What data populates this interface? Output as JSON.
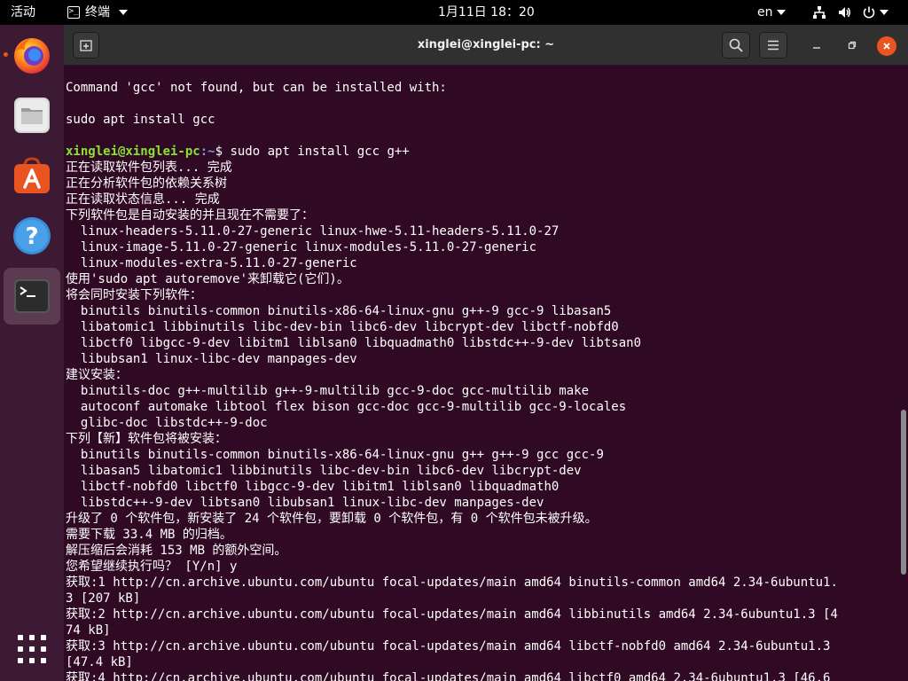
{
  "topbar": {
    "activities": "活动",
    "app_name": "终端",
    "app_icon_glyph": ">_",
    "clock": "1月11日  18：20",
    "input_method": "en"
  },
  "dock": {
    "items": [
      "firefox-icon",
      "files-icon",
      "ubuntu-software-icon",
      "help-icon",
      "terminal-icon",
      "show-apps-icon"
    ]
  },
  "window": {
    "title": "xinglei@xinglei-pc: ~"
  },
  "terminal": {
    "prompt_user": "xinglei@xinglei-pc",
    "prompt_path": ":~",
    "prompt_symbol": "$ ",
    "command": "sudo apt install gcc g++",
    "lines_before": [
      "Command 'gcc' not found, but can be installed with:",
      "",
      "sudo apt install gcc",
      ""
    ],
    "lines_after": [
      "正在读取软件包列表... 完成",
      "正在分析软件包的依赖关系树",
      "正在读取状态信息... 完成",
      "下列软件包是自动安装的并且现在不需要了：",
      "  linux-headers-5.11.0-27-generic linux-hwe-5.11-headers-5.11.0-27",
      "  linux-image-5.11.0-27-generic linux-modules-5.11.0-27-generic",
      "  linux-modules-extra-5.11.0-27-generic",
      "使用'sudo apt autoremove'来卸载它(它们)。",
      "将会同时安装下列软件：",
      "  binutils binutils-common binutils-x86-64-linux-gnu g++-9 gcc-9 libasan5",
      "  libatomic1 libbinutils libc-dev-bin libc6-dev libcrypt-dev libctf-nobfd0",
      "  libctf0 libgcc-9-dev libitm1 liblsan0 libquadmath0 libstdc++-9-dev libtsan0",
      "  libubsan1 linux-libc-dev manpages-dev",
      "建议安装：",
      "  binutils-doc g++-multilib g++-9-multilib gcc-9-doc gcc-multilib make",
      "  autoconf automake libtool flex bison gcc-doc gcc-9-multilib gcc-9-locales",
      "  glibc-doc libstdc++-9-doc",
      "下列【新】软件包将被安装：",
      "  binutils binutils-common binutils-x86-64-linux-gnu g++ g++-9 gcc gcc-9",
      "  libasan5 libatomic1 libbinutils libc-dev-bin libc6-dev libcrypt-dev",
      "  libctf-nobfd0 libctf0 libgcc-9-dev libitm1 liblsan0 libquadmath0",
      "  libstdc++-9-dev libtsan0 libubsan1 linux-libc-dev manpages-dev",
      "升级了 0 个软件包，新安装了 24 个软件包，要卸载 0 个软件包，有 0 个软件包未被升级。",
      "需要下载 33.4 MB 的归档。",
      "解压缩后会消耗 153 MB 的额外空间。",
      "您希望继续执行吗？ [Y/n] y",
      "获取:1 http://cn.archive.ubuntu.com/ubuntu focal-updates/main amd64 binutils-common amd64 2.34-6ubuntu1.",
      "3 [207 kB]",
      "获取:2 http://cn.archive.ubuntu.com/ubuntu focal-updates/main amd64 libbinutils amd64 2.34-6ubuntu1.3 [4",
      "74 kB]",
      "获取:3 http://cn.archive.ubuntu.com/ubuntu focal-updates/main amd64 libctf-nobfd0 amd64 2.34-6ubuntu1.3",
      "[47.4 kB]",
      "获取:4 http://cn.archive.ubuntu.com/ubuntu focal-updates/main amd64 libctf0 amd64 2.34-6ubuntu1.3 [46.6"
    ]
  },
  "colors": {
    "terminal_bg": "#300a24",
    "dock_bg": "#3d1a33",
    "accent": "#e95420",
    "prompt_user": "#8ae234",
    "prompt_path": "#729fcf"
  }
}
